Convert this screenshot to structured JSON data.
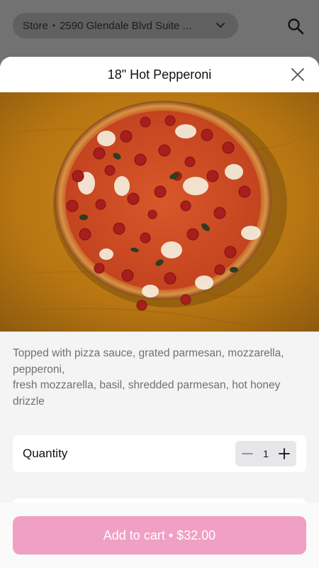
{
  "header": {
    "store_label": "Store",
    "separator": "•",
    "store_address": "2590 Glendale Blvd Suite ..."
  },
  "modal": {
    "title": "18\" Hot Pepperoni",
    "description_line1": "Topped with pizza sauce, grated parmesan, mozzarella, pepperoni,",
    "description_line2": "fresh mozzarella, basil, shredded parmesan, hot honey drizzle",
    "quantity_label": "Quantity",
    "quantity_value": "1"
  },
  "footer": {
    "cart_label": "Add to cart",
    "cart_separator": "•",
    "cart_price": "$32.00"
  },
  "colors": {
    "accent_button": "#f0a0c4",
    "backdrop": "#727272",
    "sheet_bg": "#f4f4f5"
  }
}
